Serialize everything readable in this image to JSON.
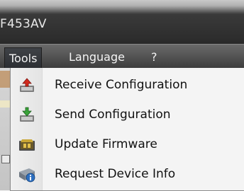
{
  "window": {
    "title": "F453AV"
  },
  "menubar": {
    "items": [
      {
        "label": "Tools",
        "open": true
      },
      {
        "label": "Language"
      },
      {
        "label": "?"
      }
    ]
  },
  "tools_menu": {
    "items": [
      {
        "label": "Receive Configuration",
        "icon": "receive-config-icon"
      },
      {
        "label": "Send Configuration",
        "icon": "send-config-icon"
      },
      {
        "label": "Update Firmware",
        "icon": "update-firmware-icon"
      },
      {
        "label": "Request Device Info",
        "icon": "device-info-icon"
      }
    ]
  },
  "colors": {
    "menubar_dark": "#3c3c3c",
    "menu_bg": "#f4f4f4",
    "text_light": "#f4f4f4"
  }
}
